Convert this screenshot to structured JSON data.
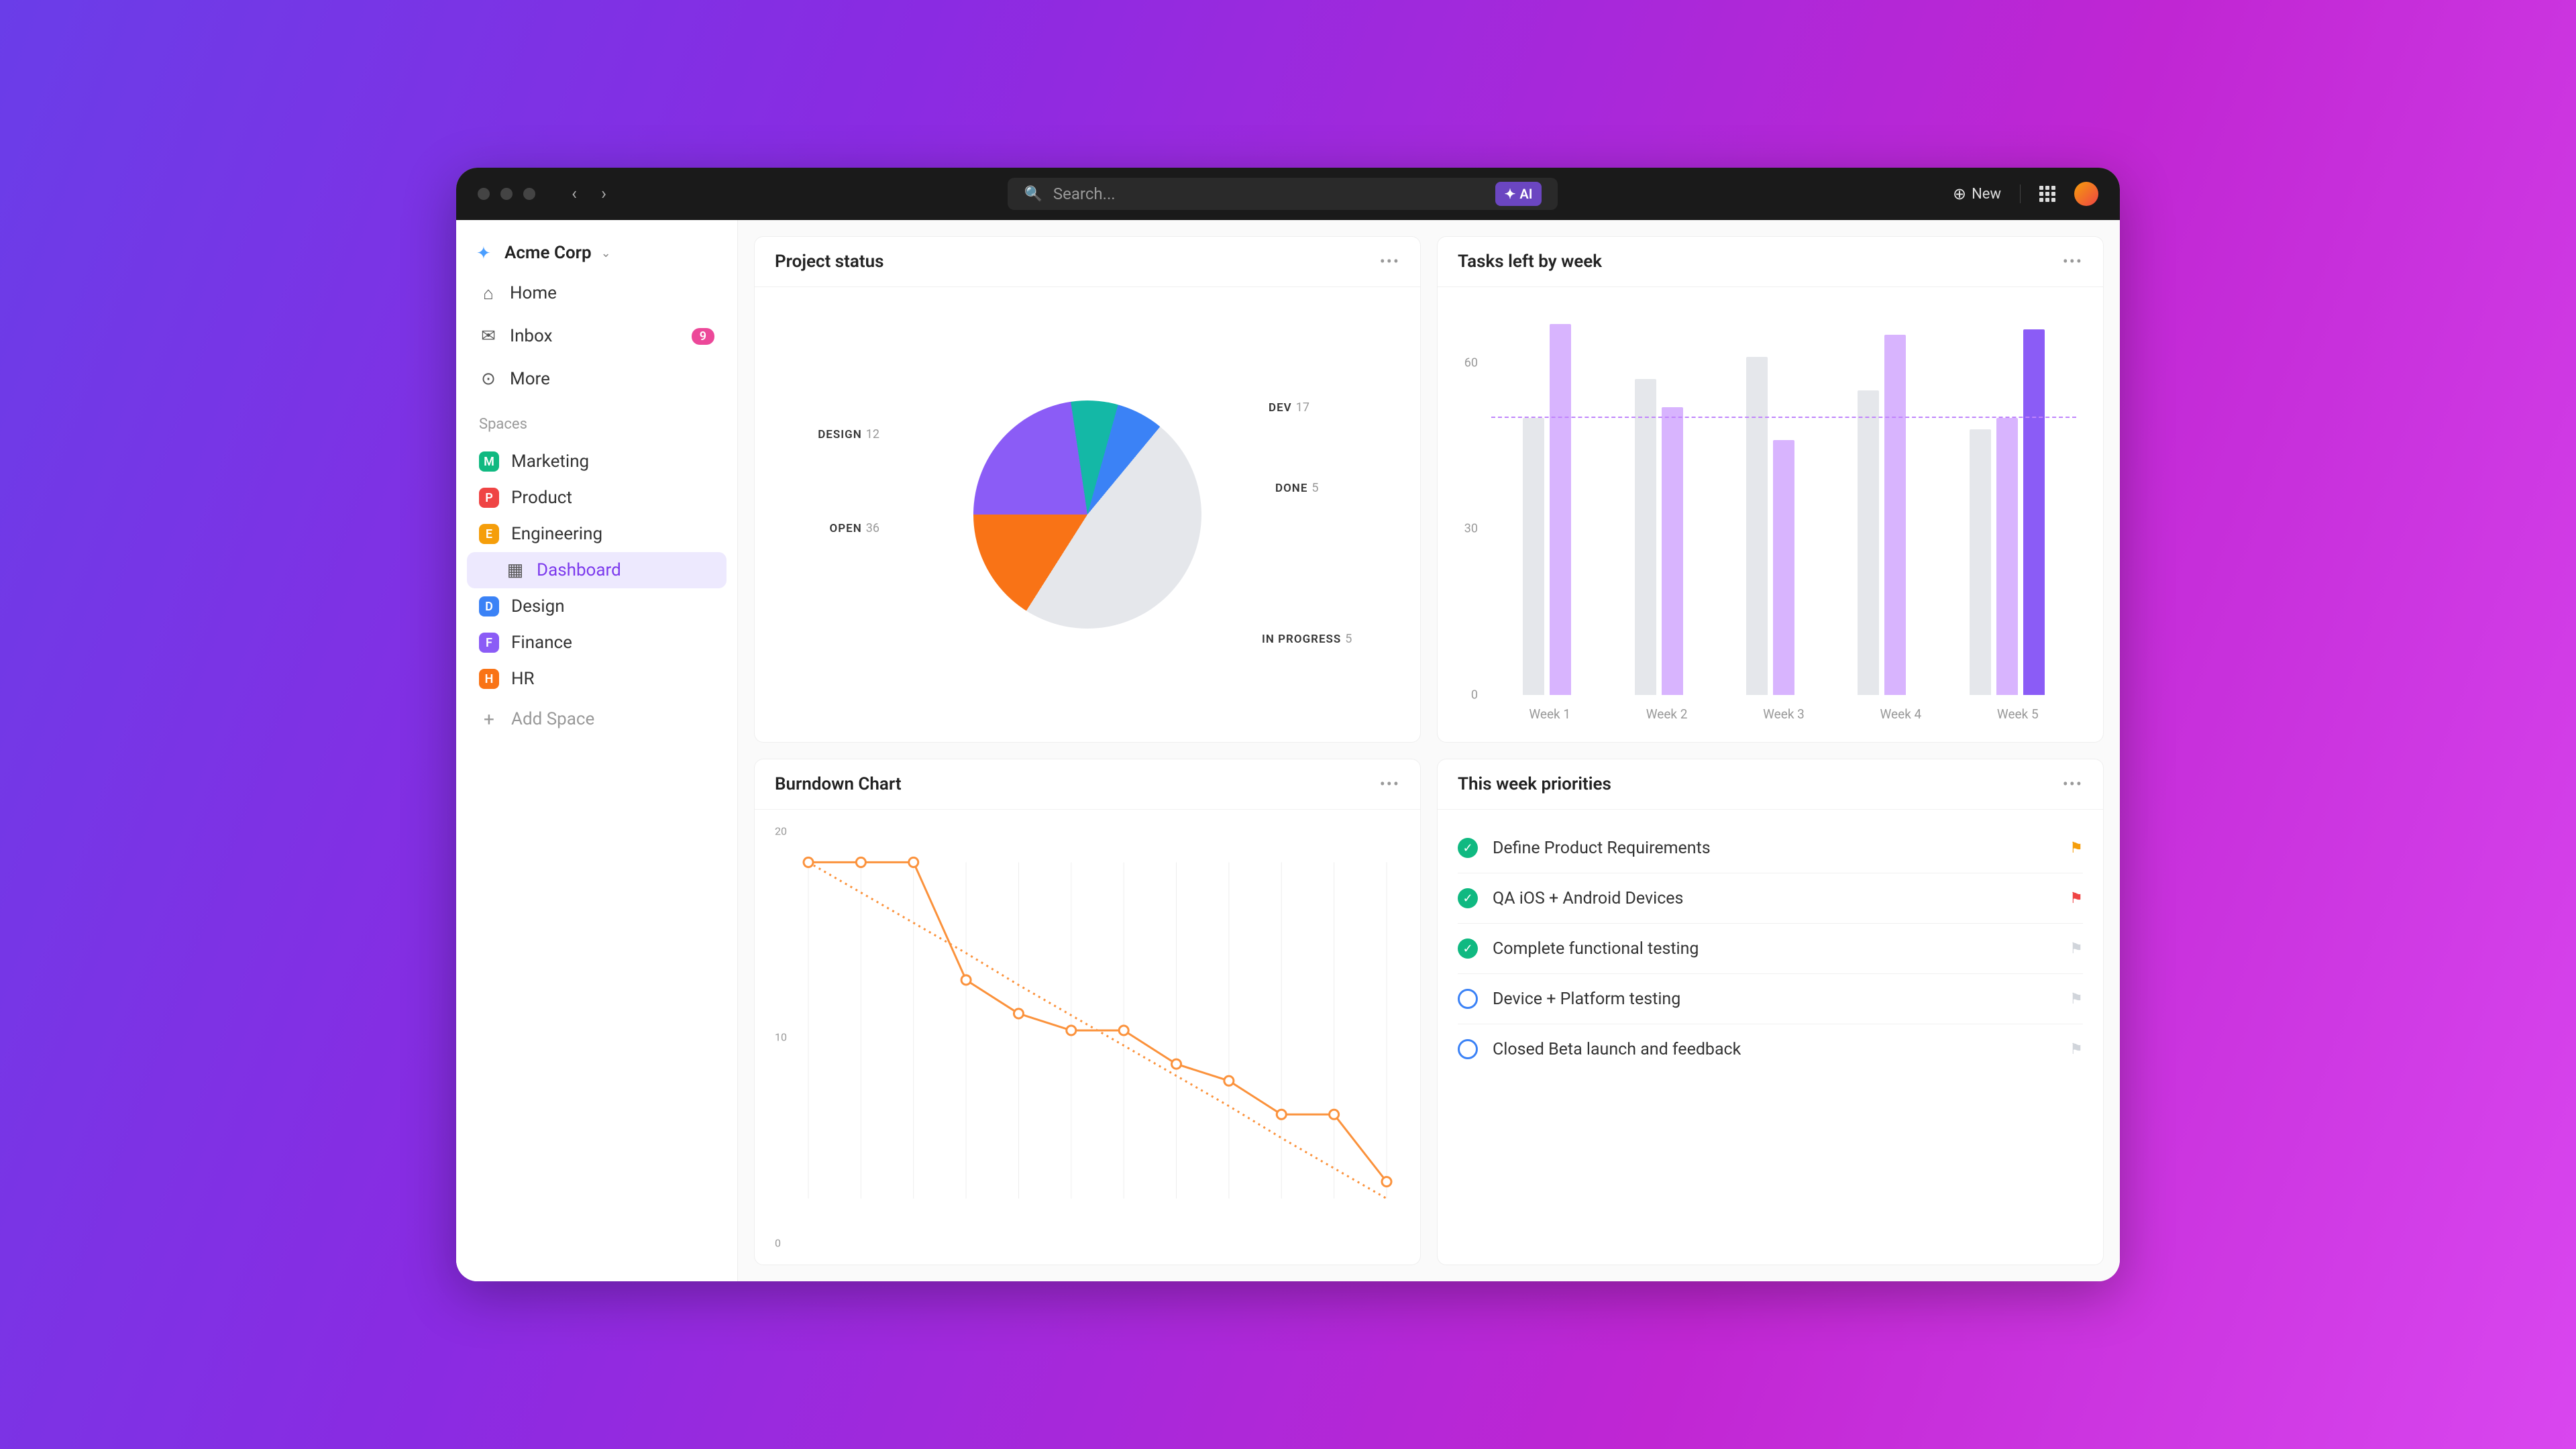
{
  "titlebar": {
    "search_placeholder": "Search...",
    "ai_label": "AI",
    "new_label": "New"
  },
  "sidebar": {
    "workspace": "Acme Corp",
    "nav": [
      {
        "icon": "home",
        "label": "Home"
      },
      {
        "icon": "inbox",
        "label": "Inbox",
        "badge": "9"
      },
      {
        "icon": "more",
        "label": "More"
      }
    ],
    "spaces_label": "Spaces",
    "spaces": [
      {
        "letter": "M",
        "color": "#10b981",
        "label": "Marketing"
      },
      {
        "letter": "P",
        "color": "#ef4444",
        "label": "Product"
      },
      {
        "letter": "E",
        "color": "#f59e0b",
        "label": "Engineering"
      },
      {
        "icon": "dashboard",
        "label": "Dashboard",
        "indented": true,
        "active": true
      },
      {
        "letter": "D",
        "color": "#3b82f6",
        "label": "Design"
      },
      {
        "letter": "F",
        "color": "#8b5cf6",
        "label": "Finance"
      },
      {
        "letter": "H",
        "color": "#f97316",
        "label": "HR"
      }
    ],
    "add_space": "Add Space"
  },
  "cards": {
    "project_status": {
      "title": "Project status"
    },
    "tasks_left": {
      "title": "Tasks left by week"
    },
    "burndown": {
      "title": "Burndown Chart"
    },
    "priorities_title": "This week priorities"
  },
  "priorities": [
    {
      "done": true,
      "text": "Define Product Requirements",
      "flag": "orange"
    },
    {
      "done": true,
      "text": "QA iOS + Android Devices",
      "flag": "red"
    },
    {
      "done": true,
      "text": "Complete functional testing",
      "flag": "gray"
    },
    {
      "done": false,
      "text": "Device + Platform testing",
      "flag": "gray"
    },
    {
      "done": false,
      "text": "Closed Beta launch and feedback",
      "flag": "gray"
    }
  ],
  "chart_data": [
    {
      "id": "project_status",
      "type": "pie",
      "title": "Project status",
      "series": [
        {
          "name": "DEV",
          "value": 17,
          "color": "#8b5cf6"
        },
        {
          "name": "DONE",
          "value": 5,
          "color": "#14b8a6"
        },
        {
          "name": "IN PROGRESS",
          "value": 5,
          "color": "#3b82f6"
        },
        {
          "name": "OPEN",
          "value": 36,
          "color": "#e5e7eb"
        },
        {
          "name": "DESIGN",
          "value": 12,
          "color": "#f97316"
        }
      ]
    },
    {
      "id": "tasks_left",
      "type": "bar",
      "title": "Tasks left by week",
      "categories": [
        "Week 1",
        "Week 2",
        "Week 3",
        "Week 4",
        "Week 5"
      ],
      "series": [
        {
          "name": "A",
          "color": "#e5e7eb",
          "values": [
            50,
            57,
            61,
            55,
            48
          ]
        },
        {
          "name": "B",
          "color": "#d8b4fe",
          "values": [
            67,
            52,
            46,
            65,
            50
          ]
        },
        {
          "name": "C",
          "color": "#8b5cf6",
          "values": [
            null,
            null,
            null,
            null,
            66
          ]
        }
      ],
      "ylim": [
        0,
        70
      ],
      "yticks": [
        0,
        30,
        60
      ],
      "reference_line": 50
    },
    {
      "id": "burndown",
      "type": "line",
      "title": "Burndown Chart",
      "x": [
        0,
        1,
        2,
        3,
        4,
        5,
        6,
        7,
        8,
        9,
        10,
        11
      ],
      "series": [
        {
          "name": "ideal",
          "style": "dotted",
          "color": "#fb923c",
          "values": [
            20,
            18.2,
            16.4,
            14.6,
            12.7,
            10.9,
            9.1,
            7.3,
            5.5,
            3.6,
            1.8,
            0
          ]
        },
        {
          "name": "actual",
          "style": "solid",
          "color": "#fb923c",
          "values": [
            20,
            20,
            20,
            13,
            11,
            10,
            10,
            8,
            7,
            5,
            5,
            1
          ]
        }
      ],
      "ylim": [
        0,
        20
      ],
      "yticks": [
        0,
        10,
        20
      ]
    }
  ]
}
